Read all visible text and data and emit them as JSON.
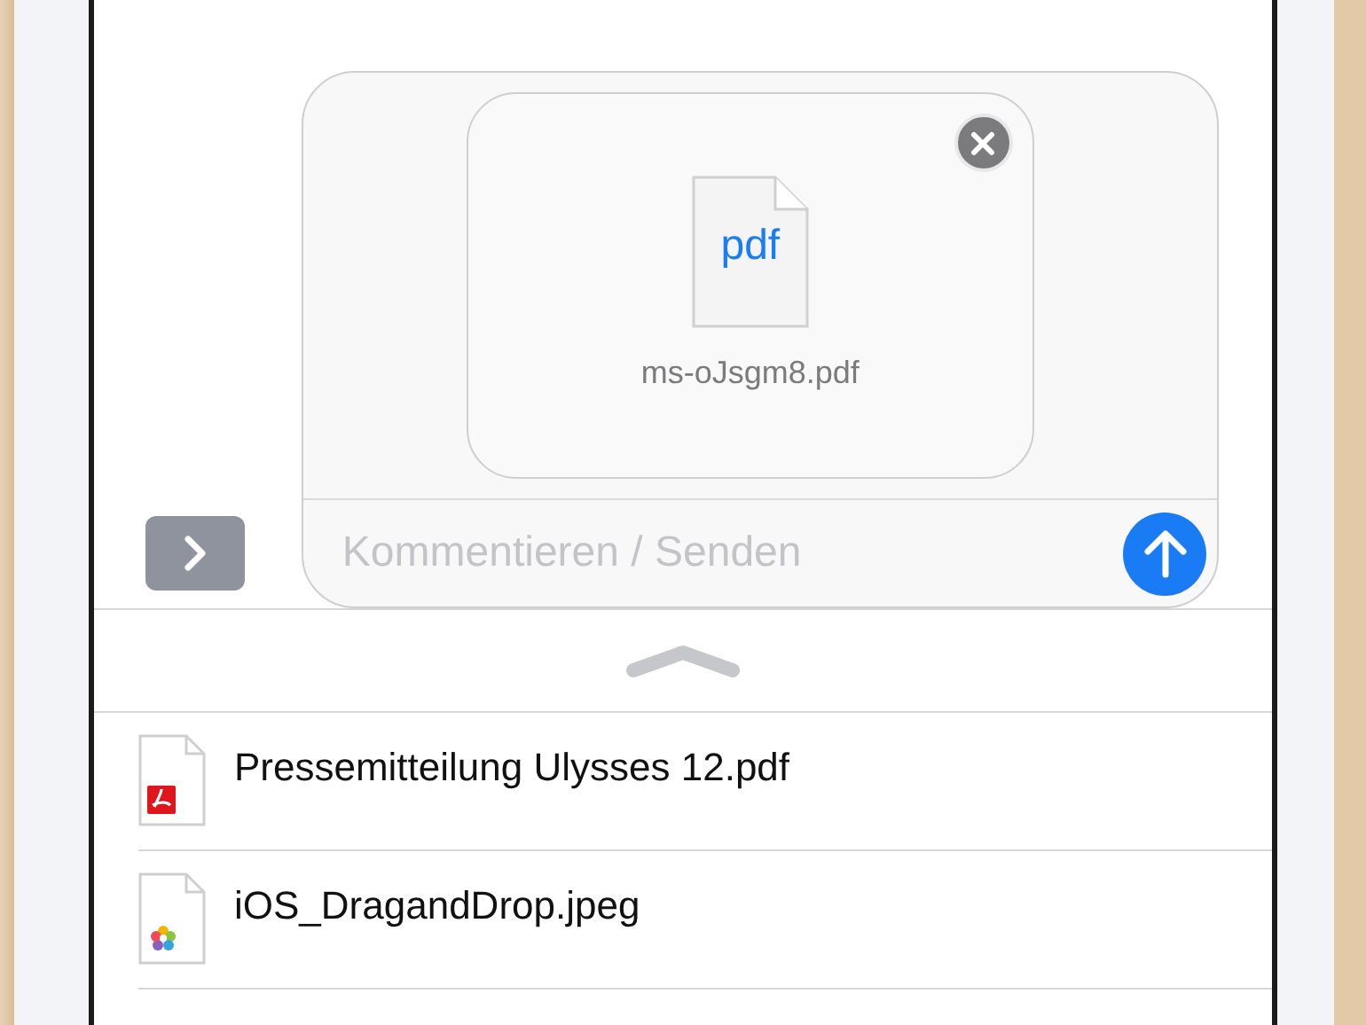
{
  "composer": {
    "attachment": {
      "type_label": "pdf",
      "filename": "ms-oJsgm8.pdf"
    },
    "input": {
      "placeholder": "Kommentieren / Senden"
    }
  },
  "files": [
    {
      "name": "Pressemitteilung Ulysses 12.pdf",
      "kind": "pdf"
    },
    {
      "name": "iOS_DragandDrop.jpeg",
      "kind": "image"
    }
  ]
}
